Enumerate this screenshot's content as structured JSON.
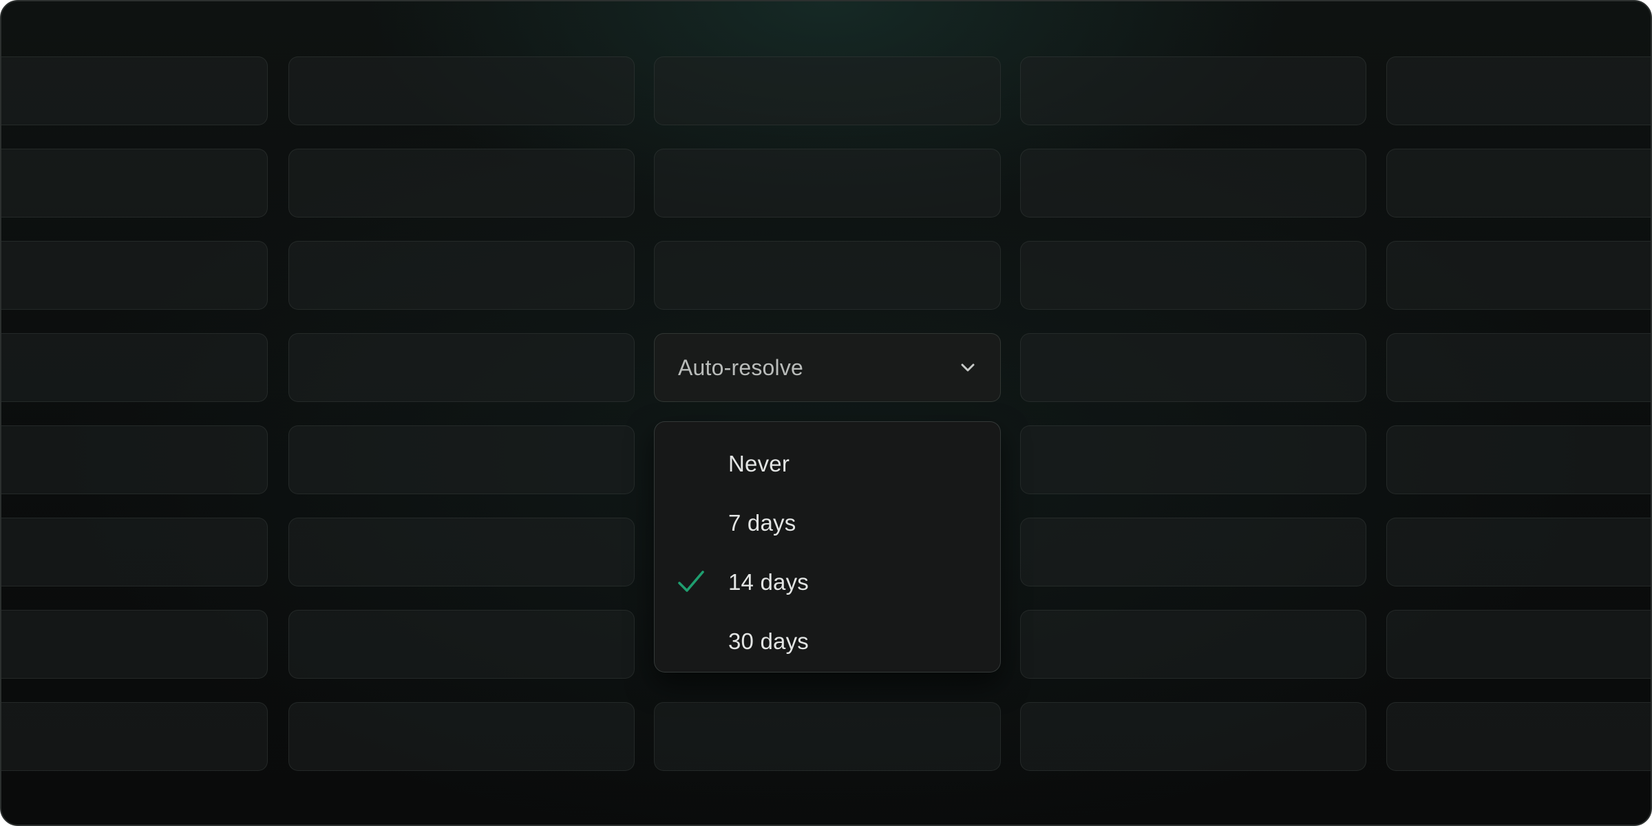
{
  "select": {
    "label": "Auto-resolve",
    "icon": "chevron-down-icon"
  },
  "menu": {
    "options": [
      {
        "label": "Never",
        "selected": false
      },
      {
        "label": "7 days",
        "selected": false
      },
      {
        "label": "14 days",
        "selected": true
      },
      {
        "label": "30 days",
        "selected": false
      }
    ],
    "check_icon": "check-icon"
  },
  "colors": {
    "accent": "#1f9e6f",
    "background": "#0c0f0e",
    "text_primary": "#e3e5e4",
    "text_secondary": "#b9bcba"
  }
}
